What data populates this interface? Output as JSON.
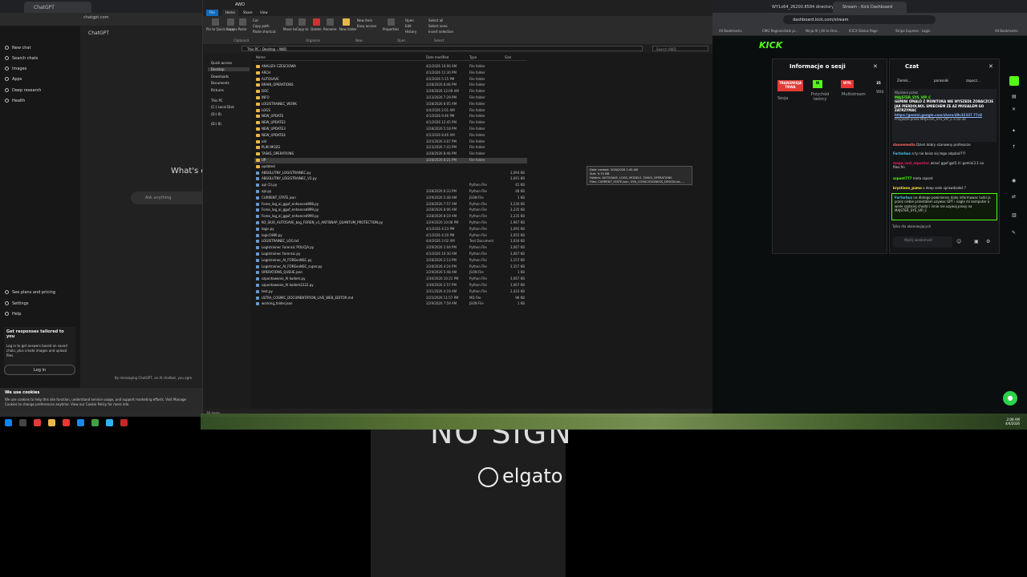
{
  "chatgpt": {
    "tab_title": "ChatGPT",
    "url": "chatgpt.com",
    "brand": "ChatGPT",
    "sidebar_items": [
      "New chat",
      "Search chats",
      "Images",
      "Apps",
      "Deep research",
      "Health"
    ],
    "bottom_items": [
      "See plans and pricing",
      "Settings",
      "Help"
    ],
    "heading": "What's o",
    "ask_placeholder": "Ask anything",
    "login_title": "Get responses tailored to you",
    "login_body": "Log in to get answers based on saved chats, plus create images and upload files.",
    "login_button": "Log in",
    "disclaimer": "By messaging ChatGPT, an AI chatbot, you agre",
    "cookies_title": "We use cookies",
    "cookies_body": "We use cookies to help this site function, understand service usage, and support marketing efforts. Visit Manage Cookies to change preferences anytime. View our Cookie Policy for more info."
  },
  "explorer": {
    "title": "AWD",
    "ribbon_tabs": [
      "File",
      "Home",
      "Share",
      "View"
    ],
    "ribbon_buttons": [
      "Pin to Quick access",
      "Copy",
      "Paste",
      "Cut",
      "Copy path",
      "Paste shortcut",
      "Move to",
      "Copy to",
      "Delete",
      "Rename",
      "New folder",
      "New item",
      "Easy access",
      "Properties",
      "Open",
      "Edit",
      "History",
      "Select all",
      "Select none",
      "Invert selection"
    ],
    "ribbon_groups": [
      "Clipboard",
      "Organize",
      "New",
      "Open",
      "Select"
    ],
    "address": [
      "This PC",
      "Desktop",
      "AWD"
    ],
    "search_placeholder": "Search AWD",
    "nav": [
      "Quick access",
      "Desktop",
      "Downloads",
      "Documents",
      "Pictures",
      "This PC",
      "(C:) Local Disk",
      "(D:) 8)",
      "(D:) 8)"
    ],
    "columns": [
      "Name",
      "Date modified",
      "Type",
      "Size"
    ],
    "rows": [
      {
        "name": "ANALIZA CZESCIOWA",
        "date": "4/2/2026 10:06 AM",
        "type": "File folder",
        "size": "",
        "kind": "folder"
      },
      {
        "name": "ARCH",
        "date": "4/1/2026 11:30 PM",
        "type": "File folder",
        "size": "",
        "kind": "folder"
      },
      {
        "name": "AUTOSAVE",
        "date": "4/2/2026 5:15 PM",
        "type": "File folder",
        "size": "",
        "kind": "folder"
      },
      {
        "name": "BRAIN_OPERATIONS",
        "date": "3/28/2026 8:46 PM",
        "type": "File folder",
        "size": "",
        "kind": "folder"
      },
      {
        "name": "DOC",
        "date": "3/28/2026 12:09 AM",
        "type": "File folder",
        "size": "",
        "kind": "folder"
      },
      {
        "name": "INFO",
        "date": "3/23/2026 7:29 PM",
        "type": "File folder",
        "size": "",
        "kind": "folder"
      },
      {
        "name": "LOGISTRAINEC_WORK",
        "date": "3/28/2026 8:05 AM",
        "type": "File folder",
        "size": "",
        "kind": "folder"
      },
      {
        "name": "LOGS",
        "date": "4/4/2026 2:01 AM",
        "type": "File folder",
        "size": "",
        "kind": "folder"
      },
      {
        "name": "NEW_UPDATE",
        "date": "4/1/2026 9:46 PM",
        "type": "File folder",
        "size": "",
        "kind": "folder"
      },
      {
        "name": "NEW_UPDATE2",
        "date": "4/1/2026 12:45 PM",
        "type": "File folder",
        "size": "",
        "kind": "folder"
      },
      {
        "name": "NEW_UPDATE3",
        "date": "3/28/2026 5:18 PM",
        "type": "File folder",
        "size": "",
        "kind": "folder"
      },
      {
        "name": "NEW_UPDATE4",
        "date": "4/2/2026 8:40 AM",
        "type": "File folder",
        "size": "",
        "kind": "folder"
      },
      {
        "name": "old",
        "date": "3/25/2026 3:07 PM",
        "type": "File folder",
        "size": "",
        "kind": "folder"
      },
      {
        "name": "PLIKI MOZG",
        "date": "3/23/2026 7:43 PM",
        "type": "File folder",
        "size": "",
        "kind": "folder"
      },
      {
        "name": "TASKS_OPERATIONS",
        "date": "3/28/2026 8:46 PM",
        "type": "File folder",
        "size": "",
        "kind": "folder"
      },
      {
        "name": "UP",
        "date": "3/28/2026 8:21 PM",
        "type": "File folder",
        "size": "",
        "kind": "folder",
        "selected": true
      },
      {
        "name": "updated",
        "date": "",
        "type": "",
        "size": "",
        "kind": "folder"
      },
      {
        "name": "ABSOLUTNY_LOGISTRAINEC.py",
        "date": "",
        "type": "",
        "size": "3,094 KB",
        "kind": "file"
      },
      {
        "name": "ABSOLUTNY_LOGISTRAINEC_V2.py",
        "date": "",
        "type": "",
        "size": "3,091 KB",
        "kind": "file"
      },
      {
        "name": "api (1).py",
        "date": "",
        "type": "Python File",
        "size": "41 KB",
        "kind": "file"
      },
      {
        "name": "api.py",
        "date": "3/28/2026 6:33 PM",
        "type": "Python File",
        "size": "48 KB",
        "kind": "file"
      },
      {
        "name": "CURRENT_STATE.json",
        "date": "3/29/2026 5:48 AM",
        "type": "JSON File",
        "size": "1 KB",
        "kind": "file"
      },
      {
        "name": "Forex_log_ai_gguf_enhanced898.py",
        "date": "3/28/2026 7:57 AM",
        "type": "Python File",
        "size": "3,230 KB",
        "kind": "file"
      },
      {
        "name": "Forex_log_ai_gguf_enhanced899.py",
        "date": "3/28/2026 8:06 AM",
        "type": "Python File",
        "size": "3,235 KB",
        "kind": "file"
      },
      {
        "name": "Forex_log_ai_gguf_enhanced999.py",
        "date": "3/28/2026 8:19 AM",
        "type": "Python File",
        "size": "3,235 KB",
        "kind": "file"
      },
      {
        "name": "KO_SIUR_AUTOSAVE_bsg_FOREN_v1_ANTISNAP_QUANTUM_PROTECTION.py",
        "date": "3/29/2026 10:08 PM",
        "type": "Python File",
        "size": "2,967 KB",
        "kind": "file"
      },
      {
        "name": "logic.py",
        "date": "4/1/2026 4:23 PM",
        "type": "Python File",
        "size": "3,095 KB",
        "kind": "file"
      },
      {
        "name": "logic1980.py",
        "date": "4/1/2026 4:20 PM",
        "type": "Python File",
        "size": "3,055 KB",
        "kind": "file"
      },
      {
        "name": "LOGISTRAINEC_LOG.txt",
        "date": "4/4/2026 2:02 AM",
        "type": "Text Document",
        "size": "3,034 KB",
        "kind": "file"
      },
      {
        "name": "Logistrainec Forensic POLICJA.py",
        "date": "3/29/2026 1:04 PM",
        "type": "Python File",
        "size": "3,067 KB",
        "kind": "file"
      },
      {
        "name": "Logistrainec Forensic.py",
        "date": "4/3/2026 10:30 AM",
        "type": "Python File",
        "size": "3,067 KB",
        "kind": "file"
      },
      {
        "name": "Logistrainec_AI_FOREenNSC.py",
        "date": "3/28/2026 2:13 PM",
        "type": "Python File",
        "size": "3,157 KB",
        "kind": "file"
      },
      {
        "name": "Logistrainec_AI_FOREenNSC_super.py",
        "date": "3/28/2026 4:24 PM",
        "type": "Python File",
        "size": "3,157 KB",
        "kind": "file"
      },
      {
        "name": "OPERATIONS_QUEUE.json",
        "date": "3/29/2026 5:48 AM",
        "type": "JSON File",
        "size": "1 KB",
        "kind": "file"
      },
      {
        "name": "szpontowanie_AI kodem.py",
        "date": "3/30/2026 10:21 PM",
        "type": "Python File",
        "size": "3,067 KB",
        "kind": "file"
      },
      {
        "name": "szpontowanie_AI kodem2222.py",
        "date": "3/30/2026 2:57 PM",
        "type": "Python File",
        "size": "3,067 KB",
        "kind": "file"
      },
      {
        "name": "test.py",
        "date": "3/31/2026 4:19 AM",
        "type": "Python File",
        "size": "2,410 KB",
        "kind": "file"
      },
      {
        "name": "ULTRA_COSMIC_DOCUMENTATION_LIVE_WEB_EDITOR.md",
        "date": "3/25/2026 11:57 PM",
        "type": "MD File",
        "size": "98 KB",
        "kind": "file"
      },
      {
        "name": "working_folder.json",
        "date": "3/29/2026 7:59 AM",
        "type": "JSON File",
        "size": "1 KB",
        "kind": "file"
      }
    ],
    "tooltip": [
      "Date created: 3/28/2026 1:45 AM",
      "Size: 9.70 MB",
      "Folders: AUTOSAVE, LOGS, MODELS, TASKS_OPERATIONS",
      "Files: CURRENT_STATE.json, SYN_CONSCIOUSNESS_DESIGN.txt, ..."
    ],
    "status": "38 items"
  },
  "kick": {
    "tabs": [
      "WY1x64_26200.8584 directory",
      "Stream - Kick Dashboard"
    ],
    "url": "dashboard.kick.com/stream",
    "bookmarks": [
      "All Bookmarks",
      "CMG Regionsstalk pr...",
      "Ninja AI | All-in-One...",
      "ICICX Status Page",
      "Stripe Express - Login",
      "All Bookmarks"
    ],
    "logo": "KICK",
    "session_title": "Informacje o sesji",
    "badges": [
      {
        "text": "TRANSMISJA TRWA",
        "color": "#e53935"
      },
      {
        "text": "W",
        "color": "#53fc18"
      },
      {
        "text": "WYŁ",
        "color": "#e53935"
      },
      {
        "text": "25",
        "color": "#141517"
      }
    ],
    "badge_labels": [
      "Sesja",
      "Przychód twórcy",
      "Multistream",
      "Wid"
    ],
    "chat_title": "Czat",
    "chat_header": [
      "Ziemik...",
      "parasolki",
      "zapęcz..."
    ],
    "pinned_label": "Wysłane przez",
    "pinned_user": "MAJSTER_SYS_VIP_C",
    "pinned_text": "GEMINI OMALO Z MONITORA NIE WYSZEDŁ ZOBACZCIE JAK PIERDOLNOL SMIECHEM ZE AZ MUSIALEM GO ZATRZYMAC",
    "pinned_link": "https://gemini.google.com/share/49c32337 77c8",
    "pinned_footer": "Przypięte przez MAJSTER_SYS_VIP_C o 02:34",
    "messages": [
      {
        "user": "dannemedia",
        "text": "Dzień dobry szanowny profesorze",
        "color": "#ff6b6b"
      },
      {
        "user": "Furtarbus",
        "text": "a ty nie boisz się tego odpalać???",
        "color": "#4fc3f7"
      },
      {
        "user": "mega_real_szpontoc",
        "text": "wrzuć gguf gpt5.4 i gemini3.1 na files.fm",
        "color": "#e91e63"
      },
      {
        "user": "szpont777",
        "text": "meta szpont",
        "color": "#53fc18"
      },
      {
        "user": "krystiano_pumo",
        "text": "a deep seek sprawdzałeś ?",
        "color": "#ffeb3b"
      }
    ],
    "highlight_user": "Furtarbus",
    "highlight_text": "no dlatego powinienes dalej informowac ludzi ja przez ciebie przestałam uzywac GPT i nagle mi komputer o wiele szybciej chodzi i innie nie uzywaj proxy na MAJSTER_SYS_VIP_C",
    "followers_only": "Tylko dla obserwujących",
    "input_placeholder": "Wyślij wiadomość"
  },
  "taskbar": {
    "time": "2:08 AM",
    "date": "4/4/2026"
  },
  "capture": {
    "no_signal": "NO SIGN",
    "elgato": "elgato"
  },
  "colors": {
    "kick_green": "#53fc18",
    "folder": "#e8b84a",
    "selection": "#3d3d3d"
  }
}
